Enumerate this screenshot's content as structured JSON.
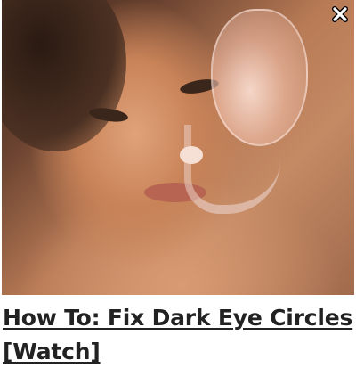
{
  "ad": {
    "title": "How To: Fix Dark Eye Circles [Watch]",
    "close_icon": "close-icon"
  }
}
